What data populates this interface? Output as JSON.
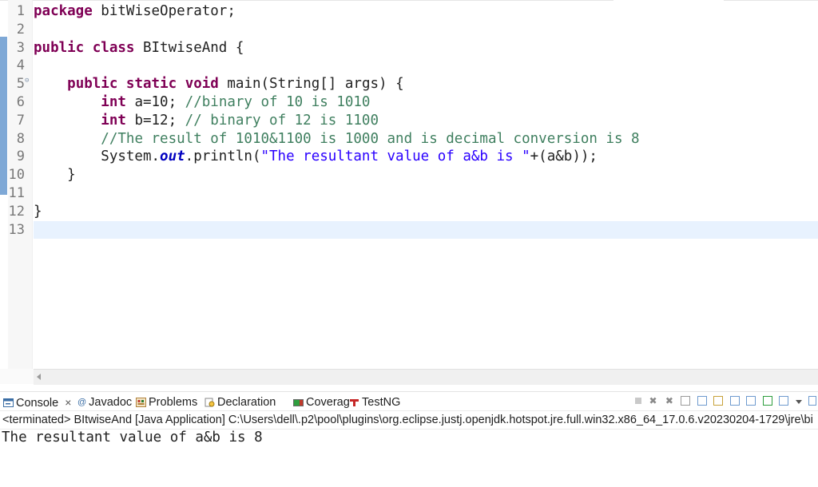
{
  "editor": {
    "lines": [
      {
        "n": "1",
        "parts": [
          {
            "t": "package",
            "c": "kw"
          },
          {
            "t": " bitWiseOperator;",
            "c": ""
          }
        ]
      },
      {
        "n": "2",
        "parts": []
      },
      {
        "n": "3",
        "parts": [
          {
            "t": "public",
            "c": "kw"
          },
          {
            "t": " ",
            "c": ""
          },
          {
            "t": "class",
            "c": "kw"
          },
          {
            "t": " BItwiseAnd {",
            "c": ""
          }
        ]
      },
      {
        "n": "4",
        "parts": []
      },
      {
        "n": "5",
        "fold": true,
        "parts": [
          {
            "t": "    ",
            "c": ""
          },
          {
            "t": "public",
            "c": "kw"
          },
          {
            "t": " ",
            "c": ""
          },
          {
            "t": "static",
            "c": "kw"
          },
          {
            "t": " ",
            "c": ""
          },
          {
            "t": "void",
            "c": "kw"
          },
          {
            "t": " main(String[] args) {",
            "c": ""
          }
        ]
      },
      {
        "n": "6",
        "parts": [
          {
            "t": "        ",
            "c": ""
          },
          {
            "t": "int",
            "c": "kw"
          },
          {
            "t": " a=10; ",
            "c": ""
          },
          {
            "t": "//binary of 10 is 1010",
            "c": "cm"
          }
        ]
      },
      {
        "n": "7",
        "parts": [
          {
            "t": "        ",
            "c": ""
          },
          {
            "t": "int",
            "c": "kw"
          },
          {
            "t": " b=12; ",
            "c": ""
          },
          {
            "t": "// binary of 12 is 1100",
            "c": "cm"
          }
        ]
      },
      {
        "n": "8",
        "parts": [
          {
            "t": "        ",
            "c": ""
          },
          {
            "t": "//The result of 1010&1100 is 1000 and is decimal conversion is 8",
            "c": "cm"
          }
        ]
      },
      {
        "n": "9",
        "parts": [
          {
            "t": "        System.",
            "c": ""
          },
          {
            "t": "out",
            "c": "fld"
          },
          {
            "t": ".println(",
            "c": ""
          },
          {
            "t": "\"The resultant value of a&b is \"",
            "c": "st"
          },
          {
            "t": "+(a&b));",
            "c": ""
          }
        ]
      },
      {
        "n": "10",
        "parts": [
          {
            "t": "    }",
            "c": ""
          }
        ]
      },
      {
        "n": "11",
        "parts": []
      },
      {
        "n": "12",
        "parts": [
          {
            "t": "}",
            "c": ""
          }
        ]
      },
      {
        "n": "13",
        "current": true,
        "parts": []
      }
    ]
  },
  "panel": {
    "tabs": [
      {
        "label": "Console",
        "icon": "console-icon",
        "closable": true,
        "active": true
      },
      {
        "label": "Javadoc",
        "icon": "javadoc-icon"
      },
      {
        "label": "Problems",
        "icon": "problems-icon"
      },
      {
        "label": "Declaration",
        "icon": "declaration-icon"
      },
      {
        "label": "Coverage",
        "icon": "coverage-icon"
      },
      {
        "label": "TestNG",
        "icon": "testng-icon"
      }
    ],
    "status": "<terminated> BItwiseAnd [Java Application] C:\\Users\\dell\\.p2\\pool\\plugins\\org.eclipse.justj.openjdk.hotspot.jre.full.win32.x86_64_17.0.6.v20230204-1729\\jre\\bi",
    "output": "The resultant value of a&b is 8",
    "close_glyph": "×"
  },
  "colors": {
    "keyword": "#7f0055",
    "comment": "#3f7f5f",
    "string": "#2a00ff",
    "field": "#0000c0"
  }
}
